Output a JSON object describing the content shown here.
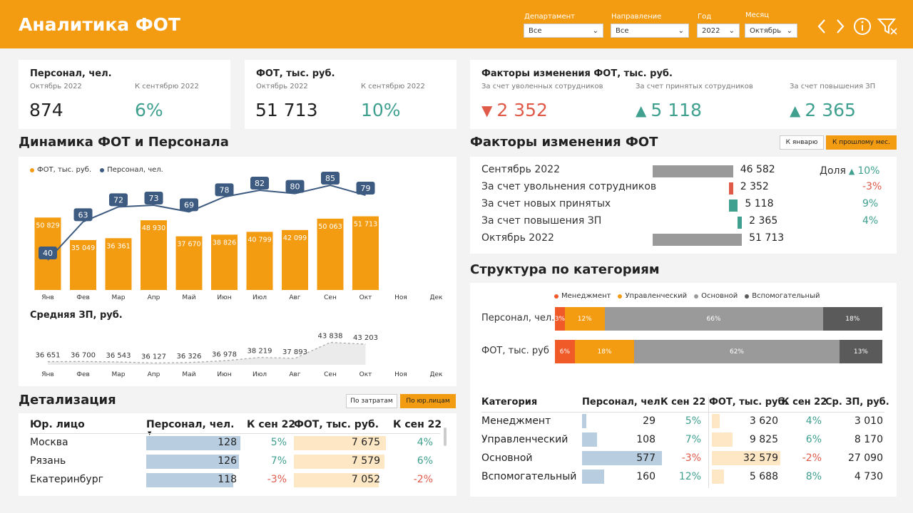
{
  "colors": {
    "accent": "#f39c12",
    "navy": "#3d5a80",
    "green": "#3fa08f",
    "red": "#e05a4a"
  },
  "header": {
    "title": "Аналитика ФОТ",
    "filters": [
      {
        "label": "Департамент",
        "value": "Все"
      },
      {
        "label": "Направление",
        "value": "Все"
      },
      {
        "label": "Год",
        "value": "2022"
      },
      {
        "label": "Месяц",
        "value": "Октябрь"
      }
    ],
    "icons": [
      "chevron-left-icon",
      "chevron-right-icon",
      "info-icon",
      "filter-clear-icon"
    ]
  },
  "kpi": [
    {
      "title": "Персонал, чел.",
      "sub1": "Октябрь 2022",
      "sub2": "К сентябрю 2022",
      "value": "874",
      "change": "6%"
    },
    {
      "title": "ФОТ, тыс. руб.",
      "sub1": "Октябрь 2022",
      "sub2": "К сентябрю 2022",
      "value": "51 713",
      "change": "10%"
    }
  ],
  "factors_card": {
    "title": "Факторы изменения ФОТ, тыс. руб.",
    "items": [
      {
        "label": "За счет уволенных сотрудников",
        "value": "2 352",
        "direction": "down"
      },
      {
        "label": "За счет принятых сотрудников",
        "value": "5 118",
        "direction": "up"
      },
      {
        "label": "За счет повышения ЗП",
        "value": "2 365",
        "direction": "up"
      }
    ]
  },
  "dynamics": {
    "title": "Динамика ФОТ и Персонала",
    "legend": [
      "ФОТ, тыс. руб.",
      "Персонал, чел."
    ],
    "avg_title": "Средняя ЗП, руб."
  },
  "chart_data": [
    {
      "type": "bar",
      "categories": [
        "Янв",
        "Фев",
        "Мар",
        "Апр",
        "Май",
        "Июн",
        "Июл",
        "Авг",
        "Сен",
        "Окт",
        "Ноя",
        "Дек"
      ],
      "series": [
        {
          "name": "ФОТ, тыс. руб.",
          "values": [
            50829,
            35049,
            36361,
            48930,
            37670,
            38826,
            40799,
            42099,
            50063,
            51713,
            null,
            null
          ]
        },
        {
          "name": "Персонал, чел.",
          "values": [
            40,
            63,
            72,
            73,
            69,
            78,
            82,
            80,
            85,
            79,
            null,
            null
          ]
        }
      ],
      "data_labels": [
        "50 829",
        "35 049",
        "36 361",
        "48 930",
        "37 670",
        "38 826",
        "40 799",
        "42 099",
        "50 063",
        "51 713"
      ]
    },
    {
      "type": "area",
      "title": "Средняя ЗП, руб.",
      "categories": [
        "Янв",
        "Фев",
        "Мар",
        "Апр",
        "Май",
        "Июн",
        "Июл",
        "Авг",
        "Сен",
        "Окт",
        "Ноя",
        "Дек"
      ],
      "values": [
        36651,
        36700,
        36543,
        36127,
        36326,
        36978,
        38219,
        37893,
        43838,
        43203,
        null,
        null
      ],
      "data_labels": [
        "36 651",
        "36 700",
        "36 543",
        "36 127",
        "36 326",
        "36 978",
        "38 219",
        "37 893",
        "43 838",
        "43 203"
      ]
    }
  ],
  "factors": {
    "title": "Факторы изменения ФОТ",
    "buttons": [
      "К январю",
      "К прошлому мес."
    ],
    "share_label": "Доля",
    "rows": [
      {
        "label": "Сентябрь 2022",
        "value": "46 582",
        "share": "10%",
        "kind": "base",
        "amount": 46582
      },
      {
        "label": "За счет увольнения сотрудников",
        "value": "2 352",
        "share": "-3%",
        "kind": "neg",
        "amount": 2352
      },
      {
        "label": "За счет новых принятых",
        "value": "5 118",
        "share": "9%",
        "kind": "pos",
        "amount": 5118
      },
      {
        "label": "За счет повышения ЗП",
        "value": "2 365",
        "share": "4%",
        "kind": "pos",
        "amount": 2365
      },
      {
        "label": "Октябрь 2022",
        "value": "51 713",
        "share": "",
        "kind": "base",
        "amount": 51713
      }
    ]
  },
  "structure": {
    "title": "Структура по категориям",
    "legend": [
      {
        "name": "Менеджмент",
        "color": "#ef5a28"
      },
      {
        "name": "Управленческий",
        "color": "#f39c12"
      },
      {
        "name": "Основной",
        "color": "#9a9a9a"
      },
      {
        "name": "Вспомогательный",
        "color": "#5a5a5a"
      }
    ],
    "rows": [
      {
        "label": "Персонал, чел.",
        "segments": [
          3,
          12,
          66,
          18
        ],
        "labels": [
          "3%",
          "12%",
          "66%",
          "18%"
        ]
      },
      {
        "label": "ФОТ, тыс. руб",
        "segments": [
          6,
          18,
          62,
          13
        ],
        "labels": [
          "6%",
          "18%",
          "62%",
          "13%"
        ]
      }
    ],
    "table": {
      "headers": [
        "Категория",
        "Персонал, чел",
        "К сен 22",
        "ФОТ, тыс. руб.",
        "К сен 22",
        "Ср. ЗП, руб."
      ],
      "rows": [
        {
          "cat": "Менеджмент",
          "staff": "29",
          "staff_n": 29,
          "d1": "5%",
          "fot": "3 620",
          "fot_n": 3620,
          "d2": "4%",
          "avg": "3 010"
        },
        {
          "cat": "Управленческий",
          "staff": "108",
          "staff_n": 108,
          "d1": "7%",
          "fot": "9 825",
          "fot_n": 9825,
          "d2": "6%",
          "avg": "8 170"
        },
        {
          "cat": "Основной",
          "staff": "577",
          "staff_n": 577,
          "d1": "-3%",
          "fot": "32 579",
          "fot_n": 32579,
          "d2": "-2%",
          "avg": "27 090"
        },
        {
          "cat": "Вспомогательный",
          "staff": "160",
          "staff_n": 160,
          "d1": "12%",
          "fot": "5 688",
          "fot_n": 5688,
          "d2": "8%",
          "avg": "4 730"
        }
      ]
    }
  },
  "detail": {
    "title": "Детализация",
    "buttons": [
      "По затратам",
      "По юр.лицам"
    ],
    "headers": [
      "Юр. лицо",
      "Персонал, чел.",
      "К сен 22",
      "ФОТ, тыс. руб.",
      "К сен 22"
    ],
    "rows": [
      {
        "name": "Москва",
        "staff": "128",
        "staff_n": 128,
        "d1": "5%",
        "fot": "7 675",
        "fot_n": 7675,
        "d2": "4%"
      },
      {
        "name": "Рязань",
        "staff": "126",
        "staff_n": 126,
        "d1": "7%",
        "fot": "7 579",
        "fot_n": 7579,
        "d2": "6%"
      },
      {
        "name": "Екатеринбург",
        "staff": "118",
        "staff_n": 118,
        "d1": "-3%",
        "fot": "7 052",
        "fot_n": 7052,
        "d2": "-2%"
      }
    ]
  }
}
